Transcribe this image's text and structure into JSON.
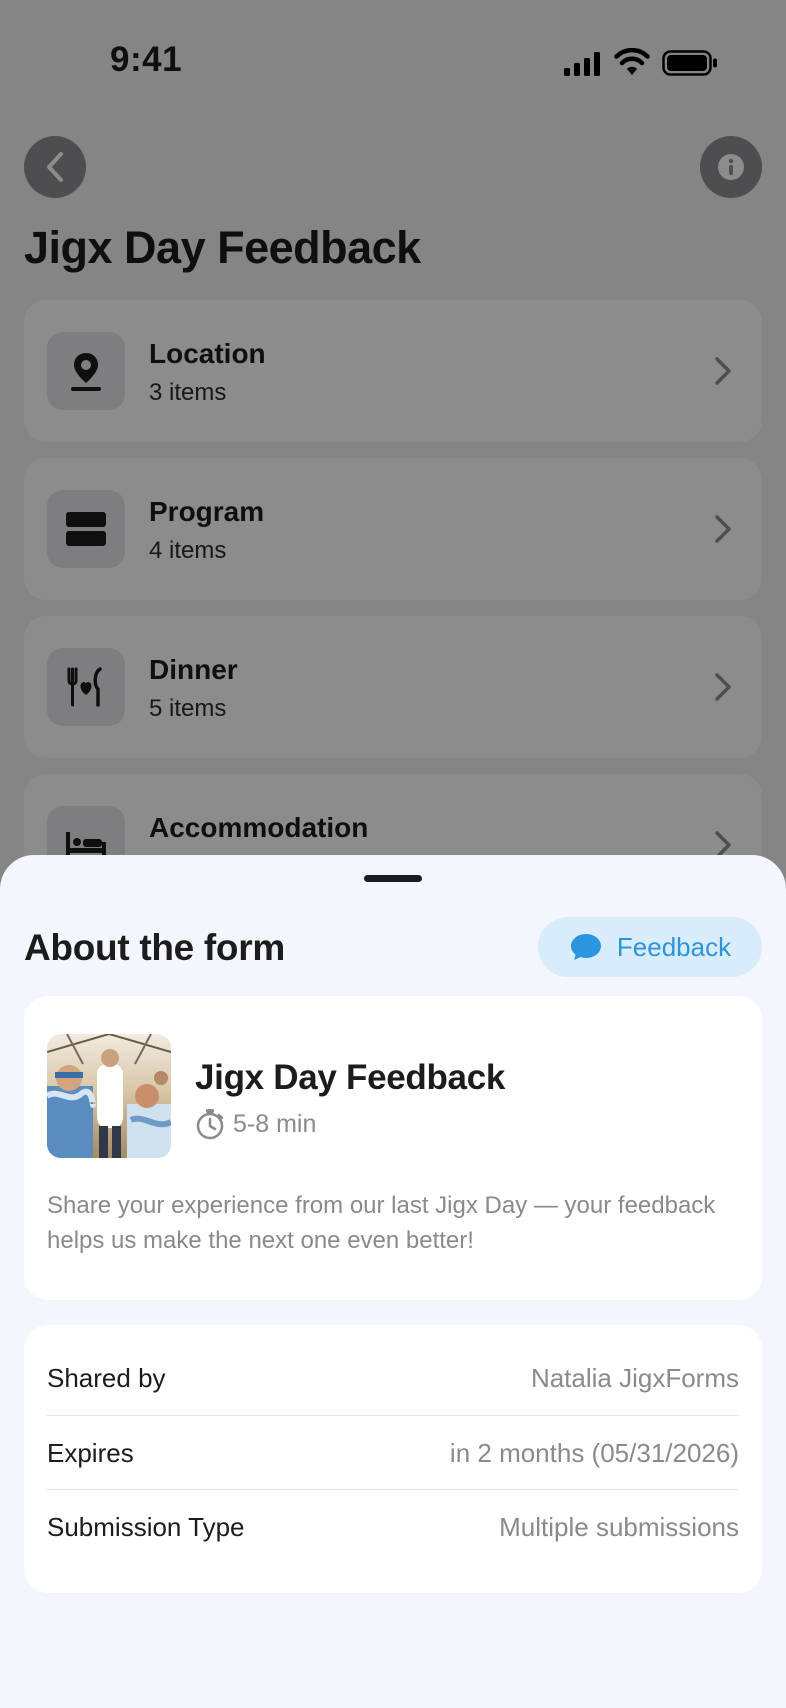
{
  "status_bar": {
    "time": "9:41"
  },
  "header": {
    "title": "Jigx Day Feedback",
    "back_icon": "chevron-left-icon",
    "info_icon": "info-icon"
  },
  "sections": [
    {
      "title": "Location",
      "count": "3 items",
      "icon": "location-pin-icon"
    },
    {
      "title": "Program",
      "count": "4 items",
      "icon": "program-icon"
    },
    {
      "title": "Dinner",
      "count": "5 items",
      "icon": "dinner-icon"
    },
    {
      "title": "Accommodation",
      "count": "",
      "icon": "bed-icon"
    }
  ],
  "sheet": {
    "title": "About the form",
    "feedback_button": "Feedback",
    "form": {
      "name": "Jigx Day Feedback",
      "duration": "5-8 min",
      "description": "Share your experience from our last Jigx Day — your feedback helps us make the next one even better!"
    },
    "details": [
      {
        "label": "Shared by",
        "value": "Natalia JigxForms"
      },
      {
        "label": "Expires",
        "value": "in 2 months (05/31/2026)"
      },
      {
        "label": "Submission Type",
        "value": "Multiple submissions"
      }
    ]
  },
  "colors": {
    "accent": "#2c95e0",
    "accent_bg": "#d9ecfb",
    "sheet_bg": "#f3f6fc"
  }
}
